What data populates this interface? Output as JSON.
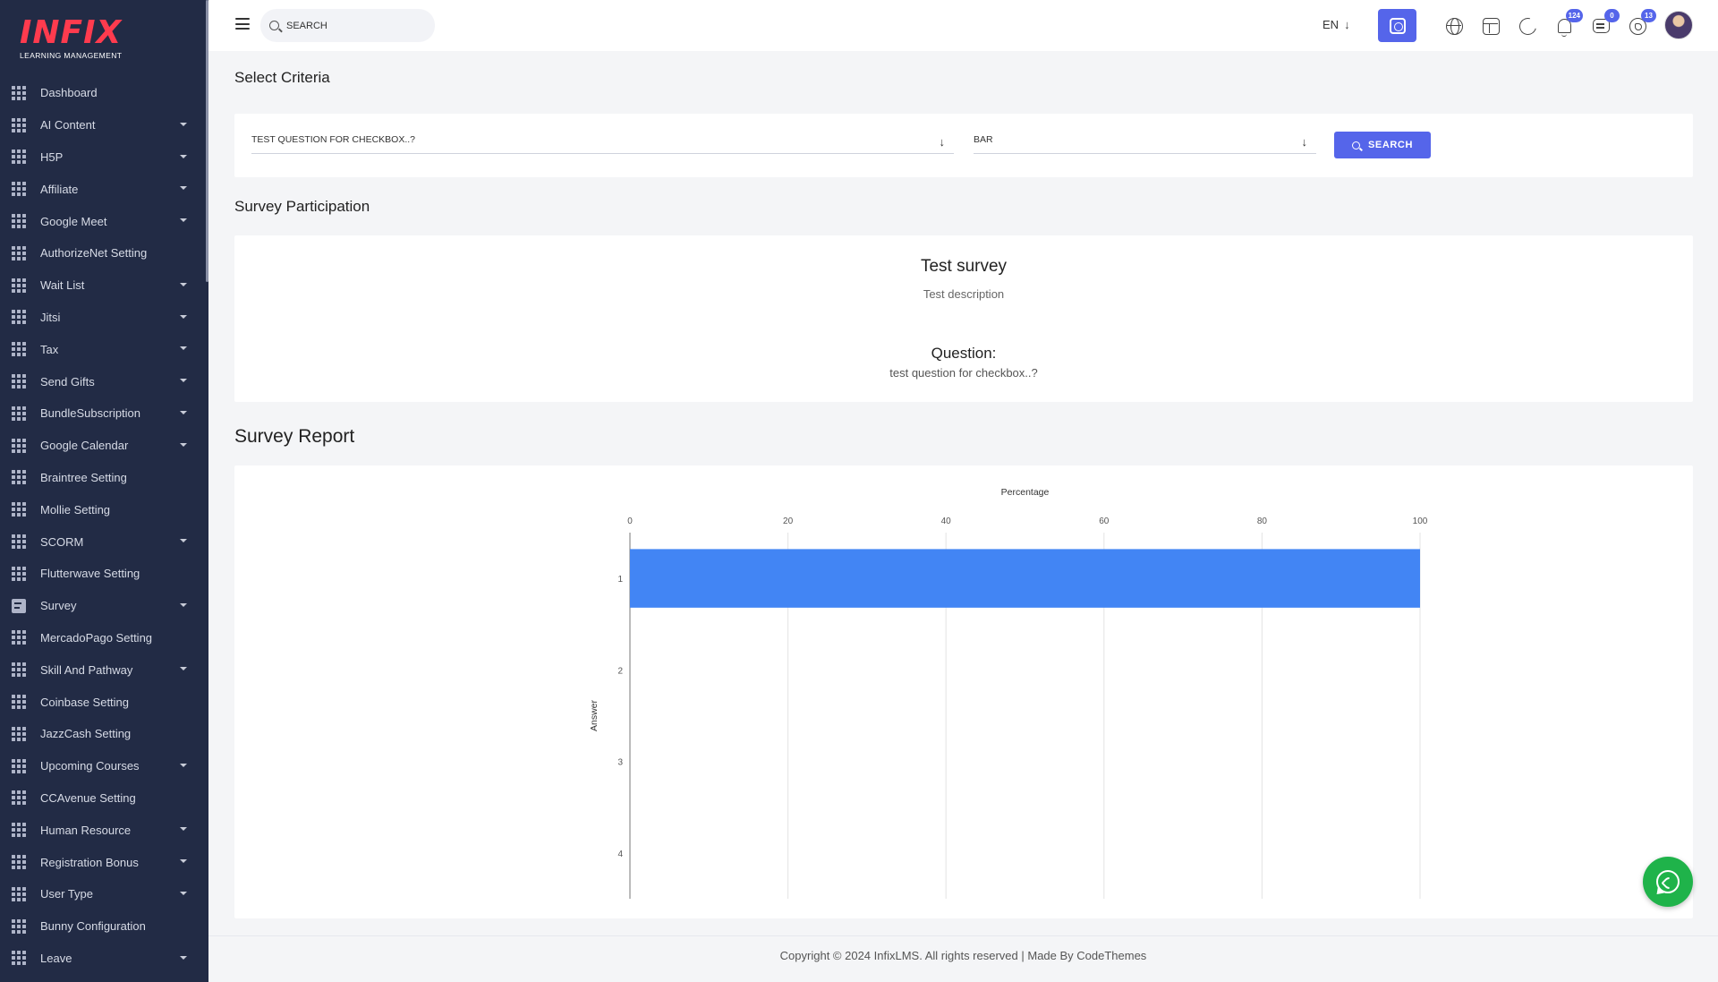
{
  "brand": {
    "logo_text": "INFIX",
    "logo_subtitle": "LEARNING MANAGEMENT",
    "logo_color": "#ff3b4e"
  },
  "sidebar": {
    "items": [
      {
        "label": "Dashboard",
        "icon": "grid-icon",
        "has_submenu": false
      },
      {
        "label": "AI Content",
        "icon": "grid-icon",
        "has_submenu": true
      },
      {
        "label": "H5P",
        "icon": "grid-icon",
        "has_submenu": true
      },
      {
        "label": "Affiliate",
        "icon": "grid-icon",
        "has_submenu": true
      },
      {
        "label": "Google Meet",
        "icon": "grid-icon",
        "has_submenu": true
      },
      {
        "label": "AuthorizeNet Setting",
        "icon": "grid-icon",
        "has_submenu": false
      },
      {
        "label": "Wait List",
        "icon": "grid-icon",
        "has_submenu": true
      },
      {
        "label": "Jitsi",
        "icon": "grid-icon",
        "has_submenu": true
      },
      {
        "label": "Tax",
        "icon": "grid-icon",
        "has_submenu": true
      },
      {
        "label": "Send Gifts",
        "icon": "grid-icon",
        "has_submenu": true
      },
      {
        "label": "BundleSubscription",
        "icon": "grid-icon",
        "has_submenu": true
      },
      {
        "label": "Google Calendar",
        "icon": "grid-icon",
        "has_submenu": true
      },
      {
        "label": "Braintree Setting",
        "icon": "grid-icon",
        "has_submenu": false
      },
      {
        "label": "Mollie Setting",
        "icon": "grid-icon",
        "has_submenu": false
      },
      {
        "label": "SCORM",
        "icon": "grid-icon",
        "has_submenu": true
      },
      {
        "label": "Flutterwave Setting",
        "icon": "grid-icon",
        "has_submenu": false
      },
      {
        "label": "Survey",
        "icon": "survey-doc-icon",
        "has_submenu": true
      },
      {
        "label": "MercadoPago Setting",
        "icon": "grid-icon",
        "has_submenu": false
      },
      {
        "label": "Skill And Pathway",
        "icon": "grid-icon",
        "has_submenu": true
      },
      {
        "label": "Coinbase Setting",
        "icon": "grid-icon",
        "has_submenu": false
      },
      {
        "label": "JazzCash Setting",
        "icon": "grid-icon",
        "has_submenu": false
      },
      {
        "label": "Upcoming Courses",
        "icon": "grid-icon",
        "has_submenu": true
      },
      {
        "label": "CCAvenue Setting",
        "icon": "grid-icon",
        "has_submenu": false
      },
      {
        "label": "Human Resource",
        "icon": "grid-icon",
        "has_submenu": true
      },
      {
        "label": "Registration Bonus",
        "icon": "grid-icon",
        "has_submenu": true
      },
      {
        "label": "User Type",
        "icon": "grid-icon",
        "has_submenu": true
      },
      {
        "label": "Bunny Configuration",
        "icon": "grid-icon",
        "has_submenu": false
      },
      {
        "label": "Leave",
        "icon": "grid-icon",
        "has_submenu": true
      }
    ]
  },
  "header": {
    "search_placeholder": "SEARCH",
    "language": "EN",
    "notifications_count": "124",
    "messages_count": "0",
    "whatsapp_count": "13",
    "accent_color": "#5565ea"
  },
  "criteria": {
    "title": "Select Criteria",
    "question_select_value": "TEST QUESTION FOR CHECKBOX..?",
    "chart_type_select_value": "BAR",
    "search_button_label": "SEARCH"
  },
  "participation": {
    "title": "Survey Participation",
    "survey_name": "Test survey",
    "survey_description": "Test description",
    "question_label": "Question:",
    "question_text": "test question for checkbox..?"
  },
  "report": {
    "title": "Survey Report"
  },
  "chart_data": {
    "type": "bar",
    "orientation": "horizontal",
    "title": "",
    "xlabel": "Percentage",
    "ylabel": "Answer",
    "xlim": [
      0,
      100
    ],
    "x_ticks": [
      0,
      20,
      40,
      60,
      80,
      100
    ],
    "x_axis_position": "top",
    "categories": [
      "1",
      "2",
      "3",
      "4"
    ],
    "values": [
      100,
      0,
      0,
      0
    ],
    "bar_color": "#4285f4",
    "grid": true
  },
  "footer": {
    "text": "Copyright © 2024 InfixLMS. All rights reserved | Made By CodeThemes"
  }
}
